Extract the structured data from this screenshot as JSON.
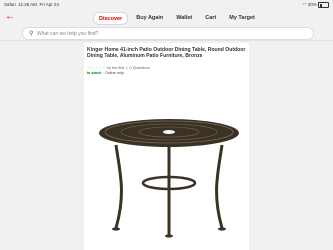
{
  "status_bar": {
    "carrier": "Safari",
    "time": "11:25 AM",
    "date": "Fri Apr 24",
    "battery": "20%"
  },
  "nav": {
    "back_icon": "chevron-left-icon",
    "tabs": [
      {
        "label": "Discover",
        "active": true
      },
      {
        "label": "Buy Again",
        "active": false
      },
      {
        "label": "Wallet",
        "active": false
      },
      {
        "label": "Cart",
        "active": false
      },
      {
        "label": "My Target",
        "active": false
      }
    ]
  },
  "search": {
    "placeholder": "What can we help you find?"
  },
  "product": {
    "title": "Kinger Home 41-inch Patio Outdoor Dining Table, Round Outdoor Dining Table, Aluminum Patio Furniture, Bronze",
    "review_text": "be the first",
    "questions": "0 Questions",
    "stock_status": "In stock",
    "stock_detail": "· Online only"
  },
  "colors": {
    "accent": "#cc0000",
    "stock": "#008300",
    "table": "#3b3226"
  }
}
